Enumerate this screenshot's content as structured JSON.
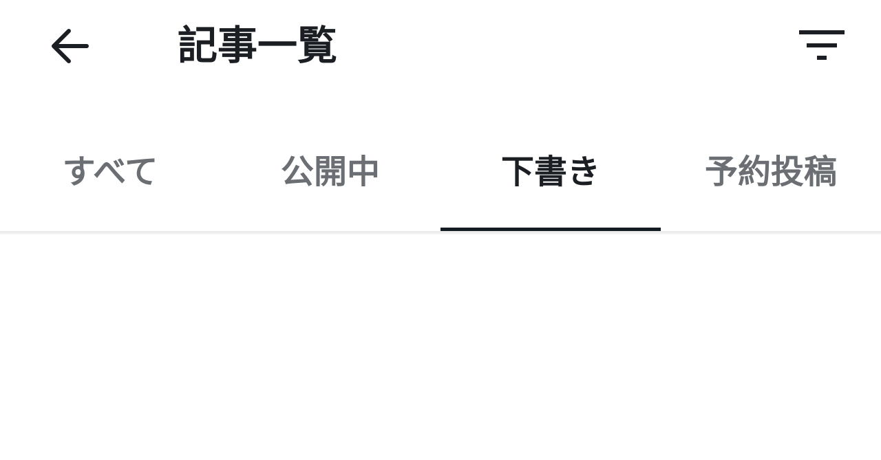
{
  "header": {
    "title": "記事一覧",
    "back_icon": "arrow-left-icon",
    "filter_icon": "filter-icon"
  },
  "tabs": [
    {
      "label": "すべて",
      "active": false
    },
    {
      "label": "公開中",
      "active": false
    },
    {
      "label": "下書き",
      "active": true
    },
    {
      "label": "予約投稿",
      "active": false
    }
  ],
  "colors": {
    "text_primary": "#1b1f24",
    "text_secondary": "#6b6f73",
    "indicator": "#131a21",
    "background": "#ffffff"
  }
}
